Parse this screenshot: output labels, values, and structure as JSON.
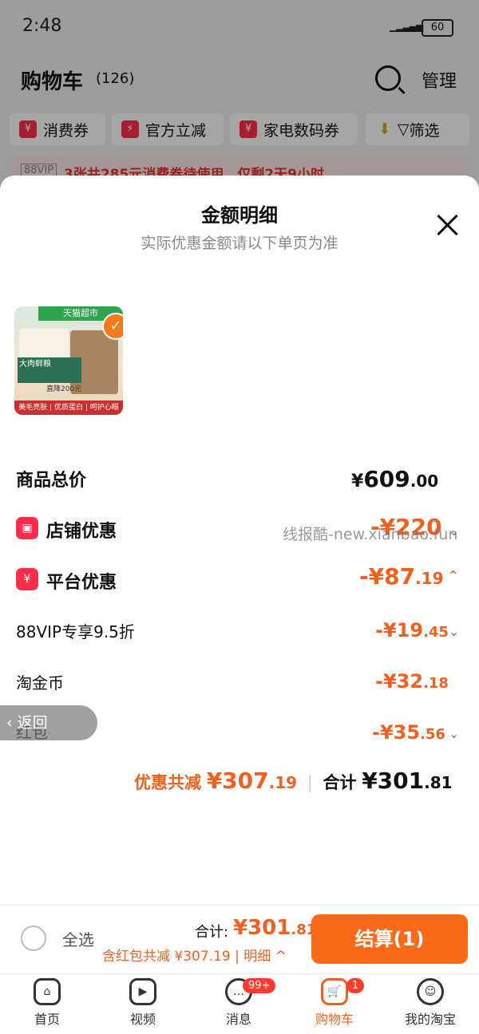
{
  "status": {
    "time": "2:48",
    "battery": "60"
  },
  "header": {
    "title": "购物车",
    "count": "(126)",
    "manage": "管理"
  },
  "chips": [
    "消费券",
    "官方立减",
    "家电数码券",
    "筛选"
  ],
  "vip_banner": {
    "badge": "88VIP",
    "text": "3张共285元消费券待使用，仅剩2天9小时"
  },
  "sheet": {
    "title": "金额明细",
    "subtitle": "实际优惠金额请以下单页为准"
  },
  "product": {
    "tag": "天猫超市",
    "strip": "美毛亮肤 | 优质蛋白 | 呵护心眼",
    "strip_tag": "严选",
    "pack_text": "大肉鲜粮",
    "price_tag": "直降200元"
  },
  "rows": {
    "total": {
      "label": "商品总价",
      "yen": "¥",
      "int": "609",
      "dec": ".00"
    },
    "shop": {
      "label": "店铺优惠",
      "amount": "-¥220"
    },
    "platform": {
      "label": "平台优惠",
      "int": "-¥87",
      "dec": ".19"
    },
    "vip": {
      "label": "88VIP专享9.5折",
      "int": "-¥19",
      "dec": ".45"
    },
    "coin": {
      "label": "淘金币",
      "int": "-¥32",
      "dec": ".18"
    },
    "redpacket": {
      "label": "红包",
      "int": "-¥35",
      "dec": ".56"
    }
  },
  "summary": {
    "discount_label": "优惠共减",
    "discount_int": "¥307",
    "discount_dec": ".19",
    "total_label": "合计",
    "total_int": "¥301",
    "total_dec": ".81"
  },
  "watermark": "线报酷-new.xianbao.fun",
  "back": "返回",
  "bottom": {
    "select_all": "全选",
    "total_label": "合计:",
    "total_int": "¥301",
    "total_dec": ".81",
    "sub": "含红包共减 ¥307.19 | 明细 ^",
    "checkout": "结算(1)"
  },
  "tabs": [
    {
      "label": "首页"
    },
    {
      "label": "视频"
    },
    {
      "label": "消息",
      "badge": "99+"
    },
    {
      "label": "购物车",
      "badge": "1"
    },
    {
      "label": "我的淘宝"
    }
  ],
  "colors": {
    "accent": "#f0601e",
    "checkout": "#fb6a18",
    "badge": "#ff2d4a"
  }
}
